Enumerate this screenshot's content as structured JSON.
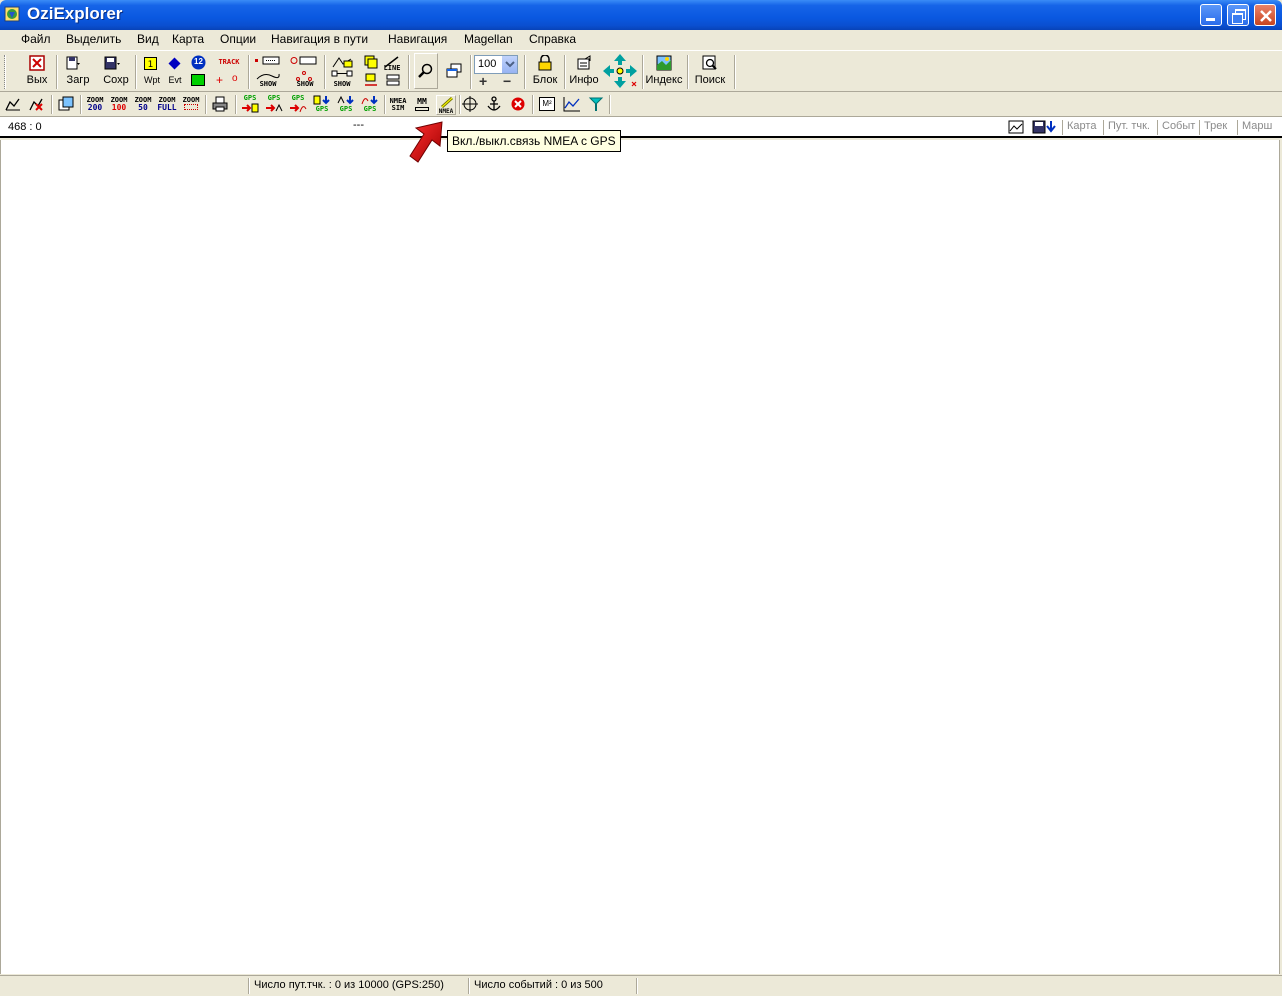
{
  "window": {
    "title": "OziExplorer"
  },
  "menu": {
    "items": [
      "Файл",
      "Выделить",
      "Вид",
      "Карта",
      "Опции",
      "Навигация в пути",
      "Навигация",
      "Magellan",
      "Справка"
    ]
  },
  "toolbar1": {
    "exit_label": "Вых",
    "load_label": "Загр",
    "save_label": "Сохр",
    "wpt_label": "Wpt",
    "evt_label": "Evt",
    "track_label": "TRACK",
    "show_label": "SHOW",
    "line_label": "LINE",
    "wpt_num": "12",
    "zoom_value": "100",
    "lock_label": "Блок",
    "info_label": "Инфо",
    "index_label": "Индекс",
    "search_label": "Поиск"
  },
  "toolbar2": {
    "zoom200_top": "ZOOM",
    "zoom200_bottom": "200",
    "zoom100_top": "ZOOM",
    "zoom100_bottom": "100",
    "zoom50_top": "ZOOM",
    "zoom50_bottom": "50",
    "zoomfull_top": "ZOOM",
    "zoomfull_bottom": "FULL",
    "zoomsel_top": "ZOOM",
    "gps_label": "GPS",
    "nmea_sim_top": "NMEA",
    "nmea_sim_bottom": "SIM",
    "mm_label": "MM",
    "nmea_label": "NMEA",
    "m2_label": "M²"
  },
  "info_row": {
    "coords": "468 : 0",
    "placeholder": "---",
    "tabs": [
      "Карта",
      "Пут. тчк.",
      "Событ",
      "Трек",
      "Марш"
    ]
  },
  "tooltip": {
    "text": "Вкл./выкл.связь NMEA с GPS"
  },
  "status": {
    "waypoints": "Число пут.тчк. : 0 из 10000  (GPS:250)",
    "events": "Число событий : 0 из 500"
  },
  "colors": {
    "titlebar": "#0A58E0",
    "chrome": "#ECE9D8",
    "map_bg": "#FFFFFF",
    "tooltip_bg": "#FFFFE1",
    "pointer_arrow": "#D40000"
  }
}
